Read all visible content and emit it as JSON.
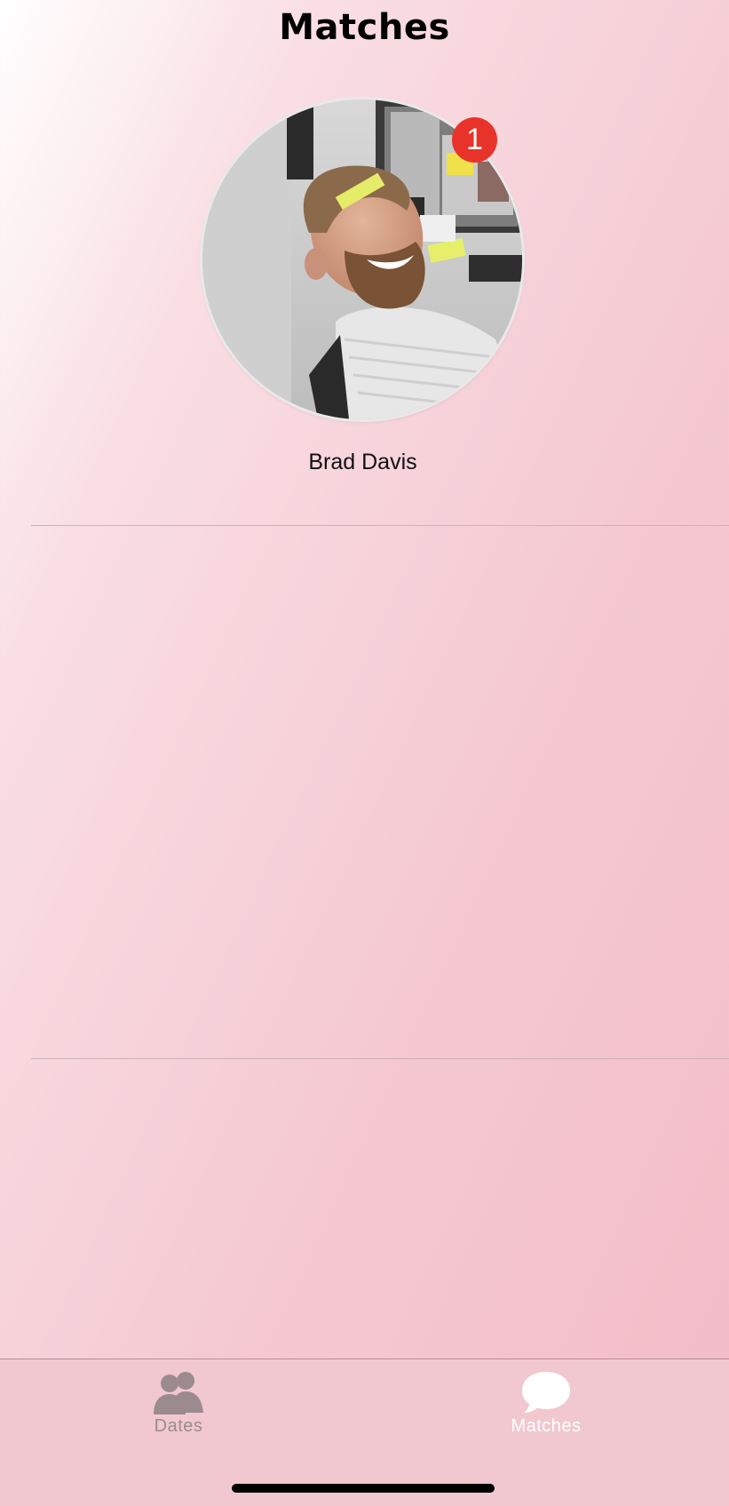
{
  "nav": {
    "title": "Matches"
  },
  "matches": [
    {
      "name": "Brad Davis",
      "unread_count": "1",
      "photo_icon": "profile-photo"
    }
  ],
  "tabs": [
    {
      "label": "Dates",
      "icon": "two-people-icon",
      "selected": false
    },
    {
      "label": "Matches",
      "icon": "chat-bubble-icon",
      "selected": true
    }
  ],
  "colors": {
    "badge": "#e8332a",
    "tab_selected": "#ffffff",
    "tab_unselected": "#9b8b8f",
    "tab_bar_bg": "#f1c8d0"
  }
}
